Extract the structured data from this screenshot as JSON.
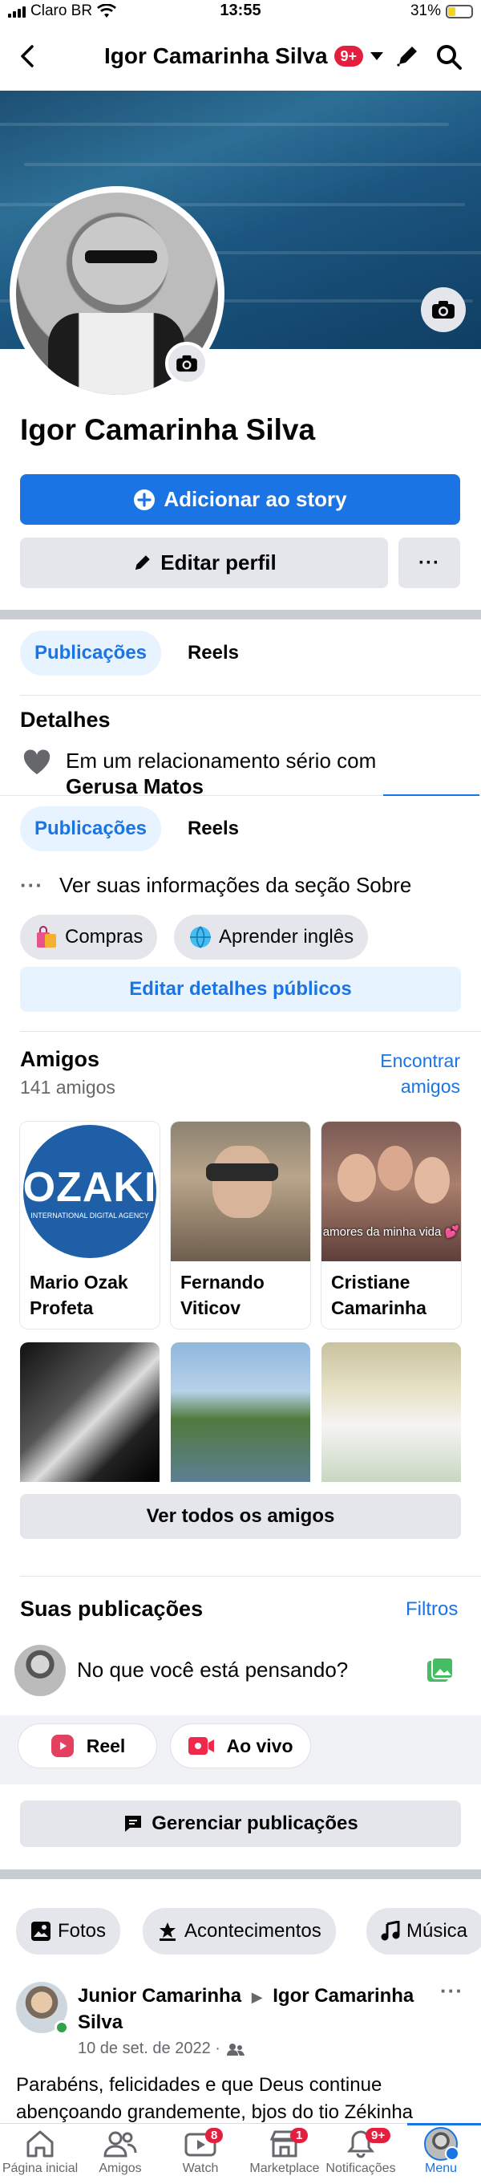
{
  "status_bar": {
    "carrier": "Claro BR",
    "time": "13:55",
    "battery": "31%",
    "battery_level": 0.31
  },
  "header": {
    "title": "Igor Camarinha Silva",
    "badge": "9+"
  },
  "profile": {
    "name": "Igor Camarinha Silva",
    "add_story": "Adicionar ao story",
    "edit_profile": "Editar perfil",
    "more": "···"
  },
  "tabs": {
    "posts": "Publicações",
    "reels": "Reels"
  },
  "details": {
    "title": "Detalhes",
    "relationship_prefix": "Em um relacionamento sério com",
    "partner": "Gerusa Matos",
    "about_link": "Ver suas informações da seção Sobre",
    "chips": [
      "Compras",
      "Aprender inglês"
    ],
    "edit_public": "Editar detalhes públicos"
  },
  "friends": {
    "title": "Amigos",
    "count": "141 amigos",
    "find": "Encontrar amigos",
    "list": [
      {
        "name": "Mario Ozak Profeta"
      },
      {
        "name": "Fernando Viticov"
      },
      {
        "name": "Cristiane Camarinha",
        "photo_caption": "amores da minha vida 💕"
      }
    ],
    "logo_text": "OZAKI",
    "logo_sub": "INTERNATIONAL DIGITAL AGENCY",
    "see_all": "Ver todos os amigos"
  },
  "your_posts": {
    "title": "Suas publicações",
    "filters": "Filtros",
    "composer_placeholder": "No que você está pensando?",
    "reel": "Reel",
    "live": "Ao vivo",
    "manage": "Gerenciar publicações"
  },
  "filters_row": [
    "Fotos",
    "Acontecimentos",
    "Música"
  ],
  "post": {
    "author": "Junior Camarinha",
    "target": "Igor Camarinha Silva",
    "date": "10 de set. de 2022 ·",
    "text": "Parabéns, felicidades e que Deus continue abençoando grandemente, bjos do tio Zékinha"
  },
  "tab_bar": [
    {
      "label": "Página inicial",
      "badge": ""
    },
    {
      "label": "Amigos",
      "badge": ""
    },
    {
      "label": "Watch",
      "badge": "8"
    },
    {
      "label": "Marketplace",
      "badge": "1"
    },
    {
      "label": "Notificações",
      "badge": "9+"
    },
    {
      "label": "Menu",
      "badge": ""
    }
  ],
  "colors": {
    "accent": "#1b74e4",
    "badge": "#e41e3f",
    "chip": "#e4e6eb"
  }
}
